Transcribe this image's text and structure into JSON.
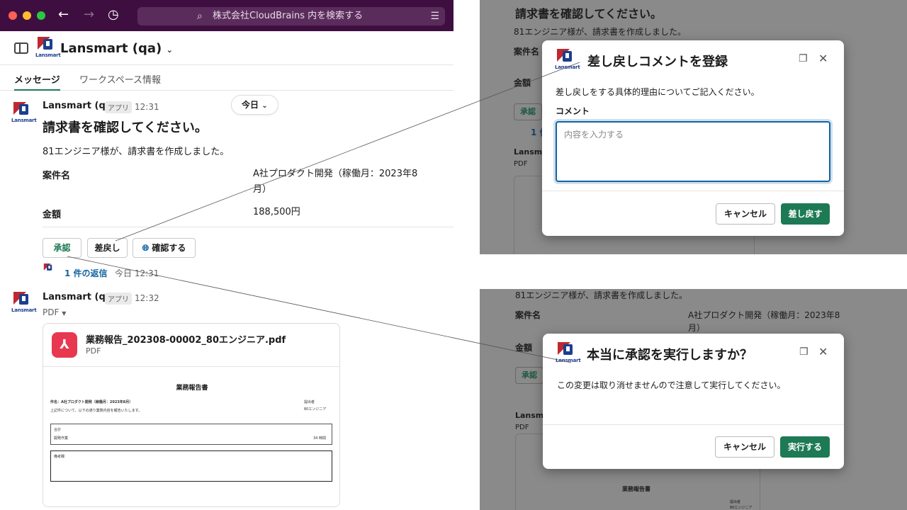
{
  "titlebar": {
    "search_placeholder": "株式会社CloudBrains 内を検索する",
    "colors": {
      "bg": "#3f0e40",
      "red": "#ff5f57",
      "yellow": "#febc2e",
      "green": "#28c840"
    }
  },
  "channel": {
    "workspace_name": "Lansmart (qa)",
    "logo_text": "Lansmart",
    "tabs": [
      {
        "label": "メッセージ",
        "active": true
      },
      {
        "label": "ワークスペース情報",
        "active": false
      }
    ]
  },
  "messages": [
    {
      "sender": "Lansmart (qa)",
      "badge": "アプリ",
      "time": "12:31",
      "title": "請求書を確認してください。",
      "text": "81エンジニア様が、請求書を作成しました。",
      "fields": [
        {
          "label": "案件名",
          "value_line1": "A社プロダクト開発（稼働月：2023年8",
          "value_line2": "月）"
        },
        {
          "label": "金額",
          "value_line1": "188,500円",
          "value_line2": ""
        }
      ],
      "buttons": {
        "approve": "承認",
        "reject": "差戻し",
        "confirm": "確認する"
      },
      "reply": {
        "count": "1 件の返信",
        "time": "今日 12:31"
      }
    },
    {
      "sender": "Lansmart (qa)",
      "badge": "アプリ",
      "time": "12:32",
      "file_label": "PDF",
      "file": {
        "name": "業務報告_202308-00002_80エンジニア.pdf",
        "type": "PDF",
        "preview": {
          "title": "業務報告書",
          "project": "件名：A社プロダクト開発（稼働月：2023年8月）",
          "desc": "上記件について、以下の通り業務内容を報告いたします。",
          "submitter_label": "提出者",
          "submitter": "80エンジニア",
          "total_label": "合計",
          "work_label": "開発作業",
          "hours": "34 時間",
          "notes_label": "備考欄"
        }
      }
    }
  ],
  "date_divider": "今日",
  "reject_modal": {
    "title": "差し戻しコメントを登録",
    "description": "差し戻しをする具体的理由についてご記入ください。",
    "field_label": "コメント",
    "placeholder": "内容を入力する",
    "cancel": "キャンセル",
    "submit": "差し戻す",
    "bg_title": "請求書を確認してください。",
    "bg_text": "81エンジニア様が、請求書を作成しました。",
    "bg_field": "案件名",
    "bg_amount": "金額",
    "bg_approve": "承認",
    "bg_reply": "1 件",
    "bg_sender": "Lansm",
    "bg_pdf": "PDF"
  },
  "approve_modal": {
    "title": "本当に承認を実行しますか？",
    "description": "この変更は取り消せませんので注意して実行してください。",
    "cancel": "キャンセル",
    "submit": "実行する",
    "bg_text": "81エンジニア様が、請求書を作成しました。",
    "bg_field": "案件名",
    "bg_value_line1": "A社プロダクト開発（稼働月：2023年8",
    "bg_value_line2": "月）",
    "bg_amount": "金額",
    "bg_approve": "承認",
    "bg_sender": "Lansm",
    "bg_pdf": "PDF",
    "bg_preview_title": "業務報告書",
    "bg_submitter_label": "提出者",
    "bg_submitter": "80エンジニア"
  },
  "icons": {
    "back": "arrow-left-icon",
    "forward": "arrow-right-icon",
    "history": "clock-icon",
    "search": "search-icon",
    "filter": "filter-icon",
    "panel": "sidebar-panel-icon",
    "chevron": "chevron-down-icon",
    "globe": "globe-icon",
    "pdf": "pdf-file-icon",
    "expand": "expand-icon",
    "close": "close-icon"
  },
  "accent_color": "#1d7a55"
}
